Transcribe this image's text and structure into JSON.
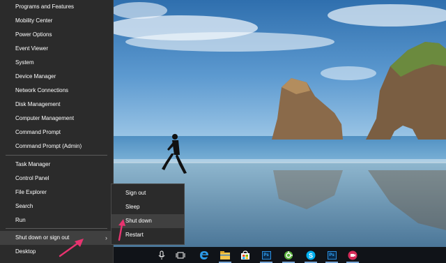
{
  "quick_link_menu": {
    "items": [
      {
        "label": "Programs and Features"
      },
      {
        "label": "Mobility Center"
      },
      {
        "label": "Power Options"
      },
      {
        "label": "Event Viewer"
      },
      {
        "label": "System"
      },
      {
        "label": "Device Manager"
      },
      {
        "label": "Network Connections"
      },
      {
        "label": "Disk Management"
      },
      {
        "label": "Computer Management"
      },
      {
        "label": "Command Prompt"
      },
      {
        "label": "Command Prompt (Admin)"
      },
      {
        "label": "Task Manager"
      },
      {
        "label": "Control Panel"
      },
      {
        "label": "File Explorer"
      },
      {
        "label": "Search"
      },
      {
        "label": "Run"
      },
      {
        "label": "Shut down or sign out"
      },
      {
        "label": "Desktop"
      }
    ],
    "submenu_chevron": "›"
  },
  "power_submenu": {
    "items": [
      {
        "label": "Sign out"
      },
      {
        "label": "Sleep"
      },
      {
        "label": "Shut down"
      },
      {
        "label": "Restart"
      }
    ],
    "highlighted": "Shut down"
  },
  "taskbar": {
    "icons": [
      "microphone-icon",
      "task-view-icon",
      "edge-icon",
      "file-explorer-icon",
      "store-icon",
      "photoshop-icon",
      "greenshot-icon",
      "skype-icon",
      "photoshop-icon",
      "recorder-icon"
    ],
    "ps_label": "Ps"
  },
  "colors": {
    "menu_bg": "#2b2b2b",
    "menu_highlight": "#404040",
    "arrow": "#e8336f",
    "taskbar_bg": "#101318"
  }
}
